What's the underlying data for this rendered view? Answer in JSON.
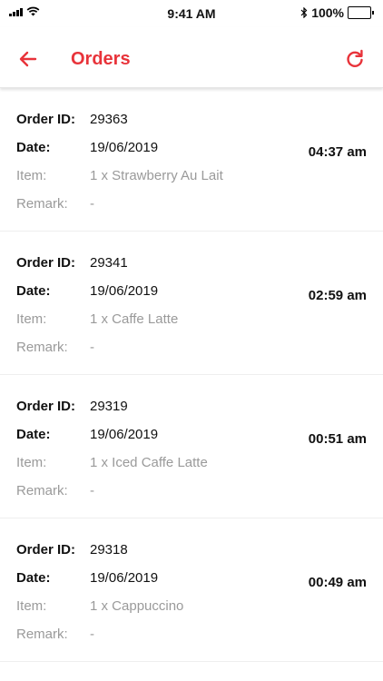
{
  "status_bar": {
    "time": "9:41 AM",
    "battery": "100%",
    "battery_level": 1.0,
    "signal_icon": "signal-bars-icon",
    "wifi_icon": "wifi-icon",
    "bluetooth_icon": "bluetooth-icon"
  },
  "app_bar": {
    "title": "Orders",
    "back_icon": "arrow-left-icon",
    "refresh_icon": "refresh-icon",
    "accent_color": "#e8333a"
  },
  "labels": {
    "order_id": "Order ID:",
    "date": "Date:",
    "item": "Item:",
    "remark": "Remark:"
  },
  "orders": [
    {
      "id": "29363",
      "date": "19/06/2019",
      "item": "1 x Strawberry Au Lait",
      "remark": "-",
      "time": "04:37 am"
    },
    {
      "id": "29341",
      "date": "19/06/2019",
      "item": "1 x Caffe Latte",
      "remark": "-",
      "time": "02:59 am"
    },
    {
      "id": "29319",
      "date": "19/06/2019",
      "item": "1 x Iced Caffe Latte",
      "remark": "-",
      "time": "00:51 am"
    },
    {
      "id": "29318",
      "date": "19/06/2019",
      "item": "1 x Cappuccino",
      "remark": "-",
      "time": "00:49 am"
    }
  ]
}
